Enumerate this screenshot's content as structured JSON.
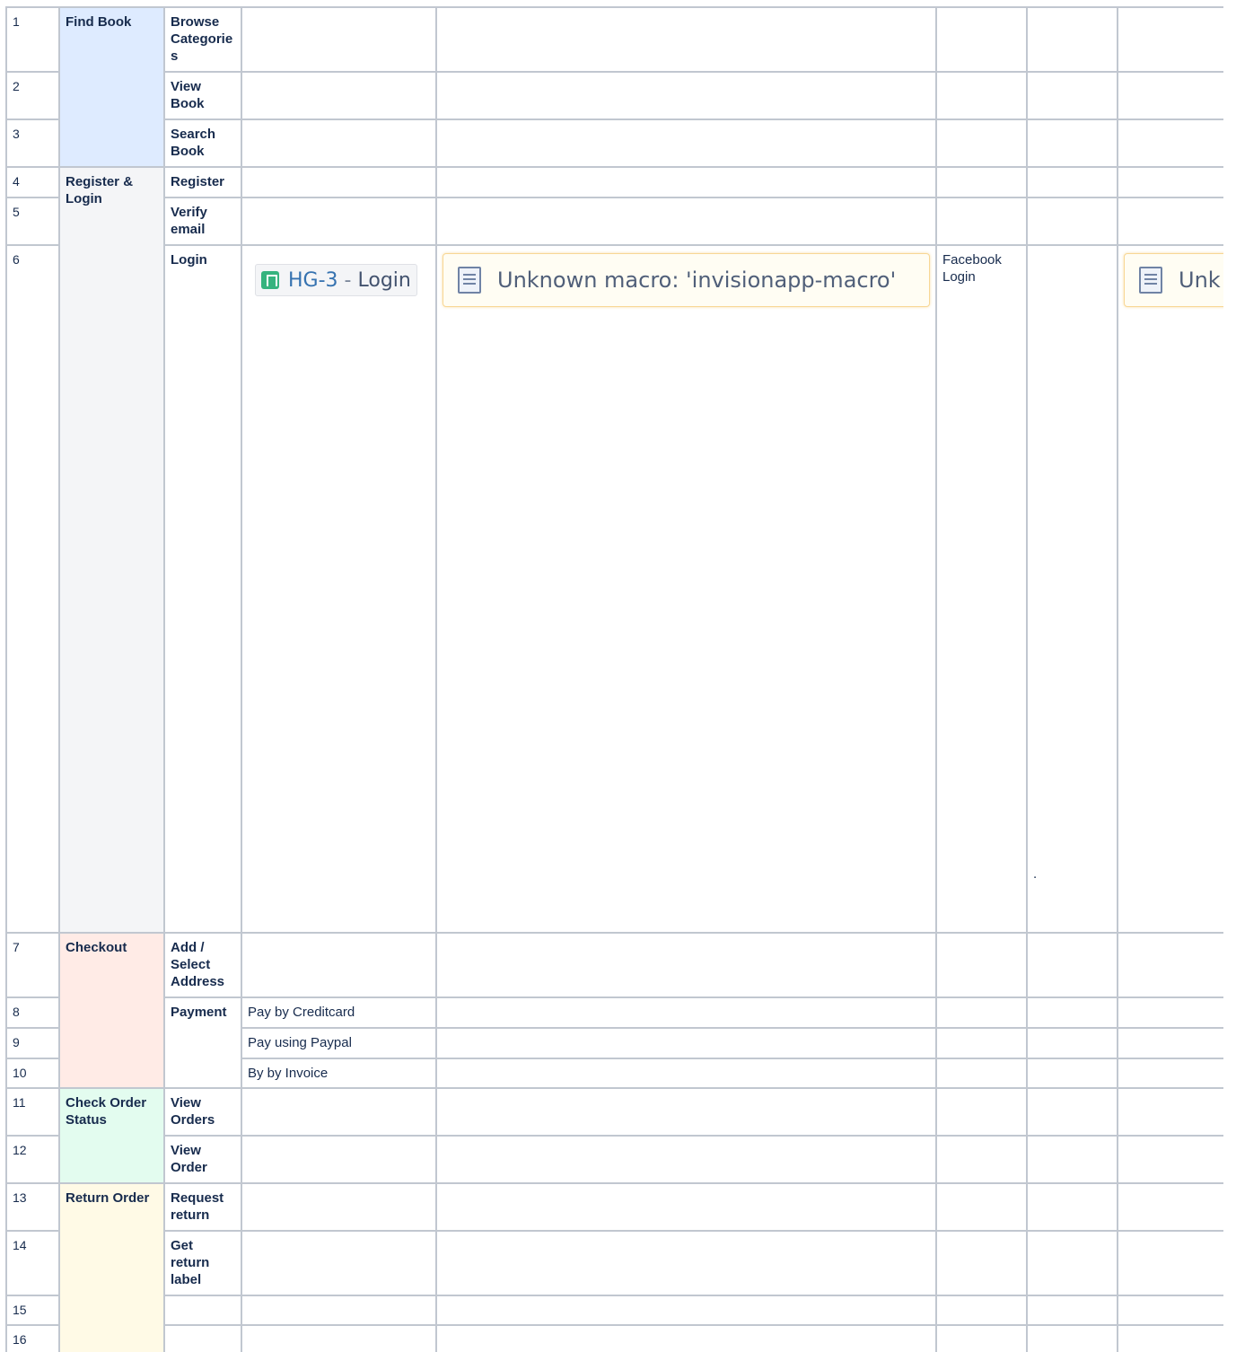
{
  "table": {
    "rows": {
      "r1": {
        "num": "1",
        "group": "Find Book",
        "feature": "Browse Categories"
      },
      "r2": {
        "num": "2",
        "feature": "View Book"
      },
      "r3": {
        "num": "3",
        "feature": "Search Book"
      },
      "r4": {
        "num": "4",
        "group": "Register & Login",
        "feature": "Register"
      },
      "r5": {
        "num": "5",
        "feature": "Verify email"
      },
      "r6": {
        "num": "6",
        "feature": "Login",
        "issue_key": "HG-3",
        "issue_sep": "-",
        "issue_title": "Login",
        "macro_text": "Unknown macro: 'invisionapp-macro'",
        "note": "Facebook Login",
        "dot": ".",
        "macro_text_clipped": "Unk"
      },
      "r7": {
        "num": "7",
        "group": "Checkout",
        "feature": "Add / Select Address"
      },
      "r8": {
        "num": "8",
        "feature": "Payment",
        "story": "Pay by Creditcard"
      },
      "r9": {
        "num": "9",
        "story": "Pay using Paypal"
      },
      "r10": {
        "num": "10",
        "story": "By by Invoice"
      },
      "r11": {
        "num": "11",
        "group": "Check Order Status",
        "feature": "View Orders"
      },
      "r12": {
        "num": "12",
        "feature": "View Order"
      },
      "r13": {
        "num": "13",
        "group": "Return Order",
        "feature": "Request return"
      },
      "r14": {
        "num": "14",
        "feature": "Get return label"
      },
      "r15": {
        "num": "15"
      },
      "r16": {
        "num": "16"
      }
    }
  },
  "colors": {
    "find_book": "#deebff",
    "register_login": "#f4f5f7",
    "checkout": "#ffebe6",
    "check_order_status": "#e3fcef",
    "return_order": "#fffae6",
    "border": "#c1c7d0"
  },
  "icons": {
    "issue": "jira-story-icon",
    "macro": "scroll-icon"
  }
}
